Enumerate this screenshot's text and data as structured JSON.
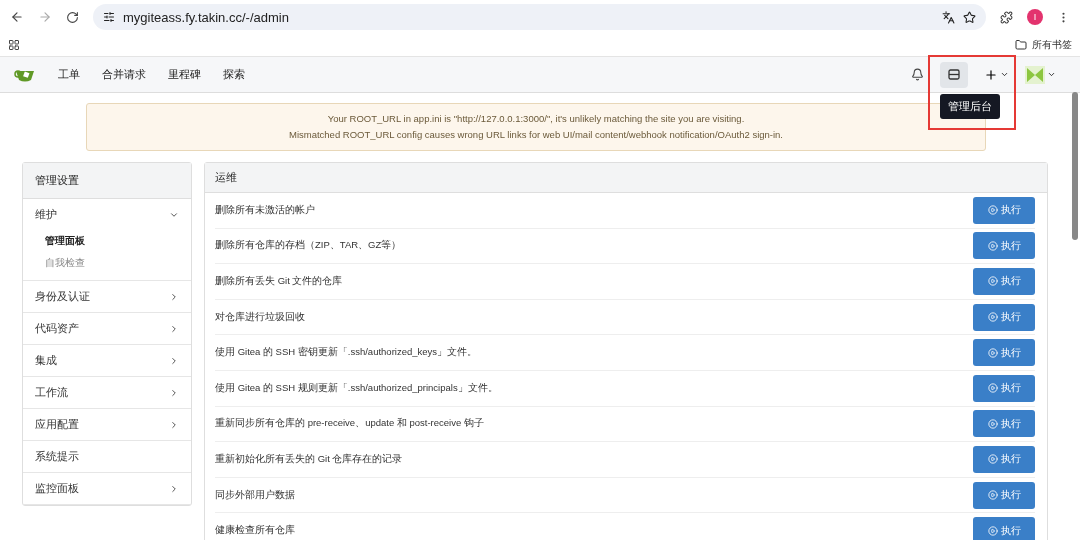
{
  "browser": {
    "url": "mygiteass.fy.takin.cc/-/admin",
    "bookmarks_folder": "所有书签",
    "profile_initial": "I"
  },
  "navbar": {
    "items": [
      {
        "label": "工单"
      },
      {
        "label": "合并请求"
      },
      {
        "label": "里程碑"
      },
      {
        "label": "探索"
      }
    ],
    "admin_tooltip": "管理后台",
    "admin_highlighted": true
  },
  "warning": {
    "lines": [
      "Your ROOT_URL in app.ini is \"http://127.0.0.1:3000/\", it's unlikely matching the site you are visiting.",
      "Mismatched ROOT_URL config causes wrong URL links for web UI/mail content/webhook notification/OAuth2 sign-in."
    ]
  },
  "sidebar": {
    "title": "管理设置",
    "items": [
      {
        "label": "维护",
        "expandable": true,
        "expanded": true,
        "children": [
          {
            "label": "管理面板",
            "selected": true
          },
          {
            "label": "自我检查",
            "selected": false
          }
        ]
      },
      {
        "label": "身份及认证",
        "expandable": true,
        "expanded": false
      },
      {
        "label": "代码资产",
        "expandable": true,
        "expanded": false
      },
      {
        "label": "集成",
        "expandable": true,
        "expanded": false
      },
      {
        "label": "工作流",
        "expandable": true,
        "expanded": false
      },
      {
        "label": "应用配置",
        "expandable": true,
        "expanded": false
      },
      {
        "label": "系统提示",
        "expandable": false
      },
      {
        "label": "监控面板",
        "expandable": true,
        "expanded": false
      }
    ]
  },
  "tasks": {
    "title": "运维",
    "rows": [
      {
        "label": "删除所有未激活的帐户",
        "action": "执行"
      },
      {
        "label": "删除所有仓库的存档（ZIP、TAR、GZ等）",
        "action": "执行"
      },
      {
        "label": "删除所有丢失 Git 文件的仓库",
        "action": "执行"
      },
      {
        "label": "对仓库进行垃圾回收",
        "action": "执行"
      },
      {
        "label": "使用 Gitea 的 SSH 密钥更新「.ssh/authorized_keys」文件。",
        "action": "执行"
      },
      {
        "label": "使用 Gitea 的 SSH 规则更新「.ssh/authorized_principals」文件。",
        "action": "执行"
      },
      {
        "label": "重新同步所有仓库的 pre-receive、update 和 post-receive 钩子",
        "action": "执行"
      },
      {
        "label": "重新初始化所有丢失的 Git 仓库存在的记录",
        "action": "执行"
      },
      {
        "label": "同步外部用户数据",
        "action": "执行"
      },
      {
        "label": "健康检查所有仓库",
        "action": "执行"
      }
    ]
  }
}
